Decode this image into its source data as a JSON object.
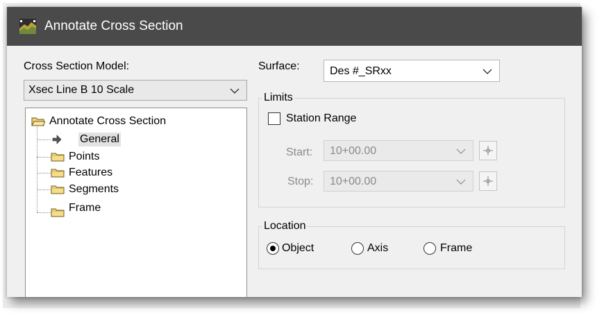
{
  "window": {
    "title": "Annotate Cross Section",
    "titlebar_color": "#4a4a4a"
  },
  "left": {
    "model_label": "Cross Section Model:",
    "model_value": "Xsec Line B 10 Scale",
    "tree": {
      "root": "Annotate Cross Section",
      "items": [
        "General",
        "Points",
        "Features",
        "Segments",
        "Frame"
      ],
      "selected": "General"
    }
  },
  "right": {
    "surface_label": "Surface:",
    "surface_value": "Des #_SRxx",
    "limits": {
      "legend": "Limits",
      "station_range_label": "Station Range",
      "station_range_checked": false,
      "start_label": "Start:",
      "start_value": "10+00.00",
      "stop_label": "Stop:",
      "stop_value": "10+00.00"
    },
    "location": {
      "legend": "Location",
      "options": [
        "Object",
        "Axis",
        "Frame"
      ],
      "selected": "Object"
    }
  },
  "icons": {
    "app": "annotate-cross-section-icon",
    "folder": "folder-icon",
    "arrow": "arrow-right-icon",
    "picker": "crosshair-pick-icon",
    "chevron": "chevron-down-icon"
  }
}
